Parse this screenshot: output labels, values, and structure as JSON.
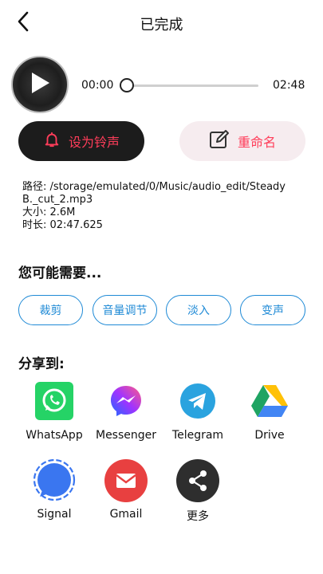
{
  "header": {
    "title": "已完成",
    "back_icon": "chevron-left-icon"
  },
  "player": {
    "current_time": "00:00",
    "total_time": "02:48",
    "progress": 0,
    "play_icon": "play-icon"
  },
  "actions": {
    "ringtone_label": "设为铃声",
    "ringtone_icon": "bell-icon",
    "rename_label": "重命名",
    "rename_icon": "edit-icon"
  },
  "file_info": {
    "path": "路径: /storage/emulated/0/Music/audio_edit/Steady B._cut_2.mp3",
    "size": "大小: 2.6M",
    "duration": "时长: 02:47.625"
  },
  "suggestions": {
    "title": "您可能需要...",
    "items": [
      "裁剪",
      "音量调节",
      "淡入",
      "变声"
    ]
  },
  "share": {
    "title": "分享到:",
    "items": [
      {
        "label": "WhatsApp",
        "icon": "whatsapp-icon",
        "color": "#25d366"
      },
      {
        "label": "Messenger",
        "icon": "messenger-icon",
        "color": "#a033ff"
      },
      {
        "label": "Telegram",
        "icon": "telegram-icon",
        "color": "#2aa3df"
      },
      {
        "label": "Drive",
        "icon": "google-drive-icon",
        "color": "#1fa463"
      },
      {
        "label": "Signal",
        "icon": "signal-icon",
        "color": "#3a76f0"
      },
      {
        "label": "Gmail",
        "icon": "gmail-icon",
        "color": "#e84040"
      },
      {
        "label": "更多",
        "icon": "share-more-icon",
        "color": "#2e2e2e"
      }
    ]
  },
  "colors": {
    "accent": "#ff3d5a",
    "chip": "#1f8ad6"
  }
}
